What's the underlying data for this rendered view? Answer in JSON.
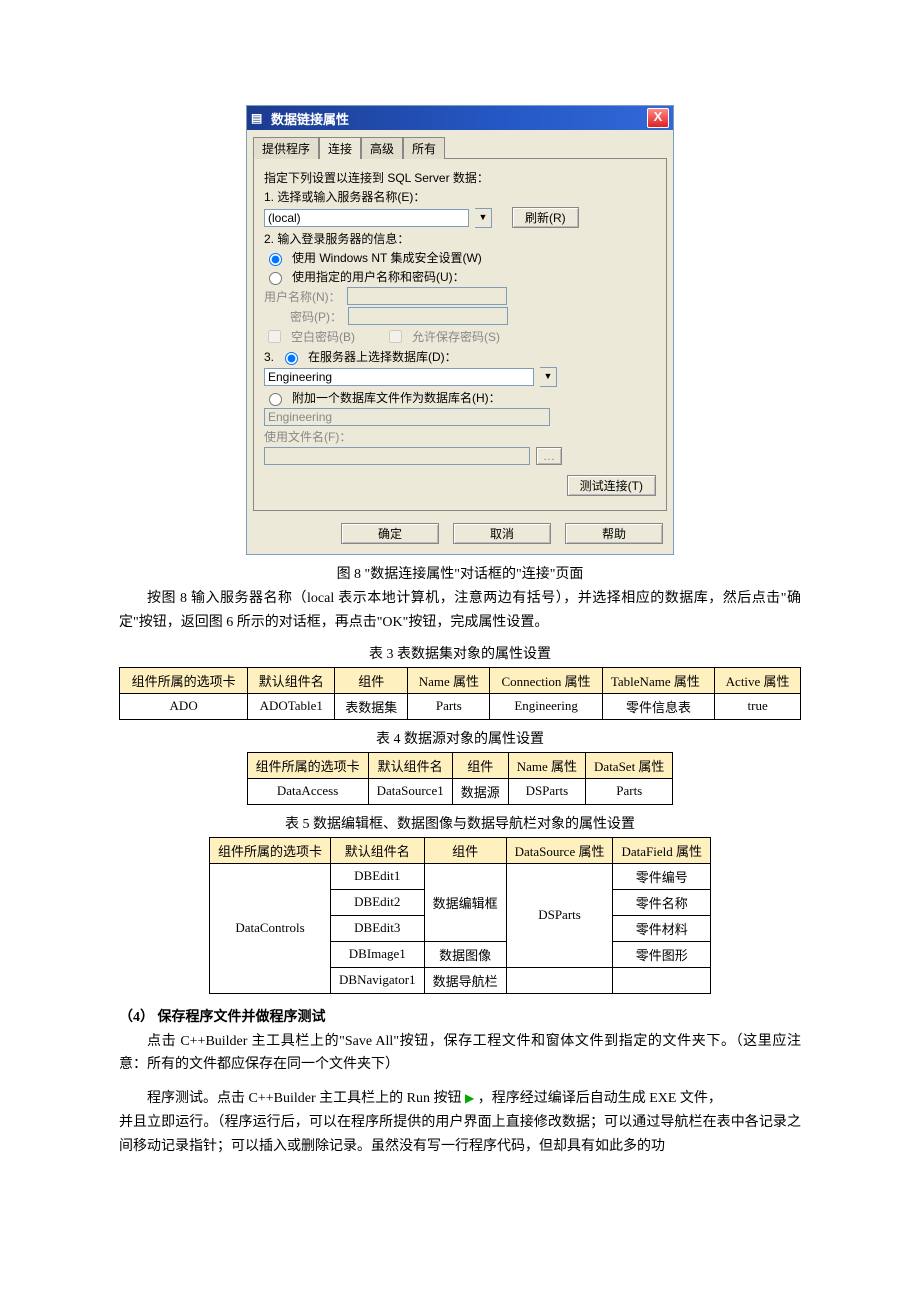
{
  "dialog": {
    "title": "数据链接属性",
    "close": "X",
    "tabs": {
      "provider": "提供程序",
      "connect": "连接",
      "advanced": "高级",
      "all": "所有"
    },
    "instruction": "指定下列设置以连接到 SQL Server 数据：",
    "step1_label": "1. 选择或输入服务器名称(E)：",
    "server_value": "(local)",
    "refresh_btn": "刷新(R)",
    "step2_label": "2. 输入登录服务器的信息：",
    "radio_nt": "使用 Windows NT 集成安全设置(W)",
    "radio_user": "使用指定的用户名称和密码(U)：",
    "uname_label": "用户名称(N)：",
    "pwd_label": "密码(P)：",
    "blank_pwd": "空白密码(B)",
    "save_pwd": "允许保存密码(S)",
    "step3_prefix": "3.",
    "radio_selectdb": "在服务器上选择数据库(D)：",
    "db_value": "Engineering",
    "radio_attach": "附加一个数据库文件作为数据库名(H)：",
    "attach_value": "Engineering",
    "usefile_label": "使用文件名(F)：",
    "browse_btn": "…",
    "test_btn": "测试连接(T)",
    "ok_btn": "确定",
    "cancel_btn": "取消",
    "help_btn": "帮助"
  },
  "figure8_caption": "图 8  \"数据连接属性\"对话框的\"连接\"页面",
  "para_after_fig8": "按图 8 输入服务器名称（local 表示本地计算机，注意两边有括号），并选择相应的数据库，然后点击\"确定\"按钮，返回图 6 所示的对话框，再点击\"OK\"按钮，完成属性设置。",
  "table3": {
    "caption": "表 3  表数据集对象的属性设置",
    "headers": [
      "组件所属的选项卡",
      "默认组件名",
      "组件",
      "Name 属性",
      "Connection 属性",
      "TableName 属性",
      "Active 属性"
    ],
    "row": [
      "ADO",
      "ADOTable1",
      "表数据集",
      "Parts",
      "Engineering",
      "零件信息表",
      "true"
    ]
  },
  "table4": {
    "caption": "表 4  数据源对象的属性设置",
    "headers": [
      "组件所属的选项卡",
      "默认组件名",
      "组件",
      "Name 属性",
      "DataSet 属性"
    ],
    "row": [
      "DataAccess",
      "DataSource1",
      "数据源",
      "DSParts",
      "Parts"
    ]
  },
  "table5": {
    "caption": "表 5  数据编辑框、数据图像与数据导航栏对象的属性设置",
    "headers": [
      "组件所属的选项卡",
      "默认组件名",
      "组件",
      "DataSource 属性",
      "DataField 属性"
    ],
    "col1": "DataControls",
    "r1": {
      "name": "DBEdit1",
      "comp": "数据编辑框",
      "ds": "DSParts",
      "df": "零件编号"
    },
    "r2": {
      "name": "DBEdit2",
      "df": "零件名称"
    },
    "r3": {
      "name": "DBEdit3",
      "df": "零件材料"
    },
    "r4": {
      "name": "DBImage1",
      "comp": "数据图像",
      "df": "零件图形"
    },
    "r5": {
      "name": "DBNavigator1",
      "comp": "数据导航栏"
    }
  },
  "section4": {
    "heading": "（4） 保存程序文件并做程序测试",
    "p1": "点击 C++Builder 主工具栏上的\"Save All\"按钮，保存工程文件和窗体文件到指定的文件夹下。（这里应注意：所有的文件都应保存在同一个文件夹下）",
    "p2_pre": "程序测试。点击 C++Builder 主工具栏上的 Run 按钮",
    "p2_post": "，程序经过编译后自动生成 EXE 文件，",
    "p3": "并且立即运行。（程序运行后，可以在程序所提供的用户界面上直接修改数据；可以通过导航栏在表中各记录之间移动记录指针；可以插入或删除记录。虽然没有写一行程序代码，但却具有如此多的功"
  }
}
